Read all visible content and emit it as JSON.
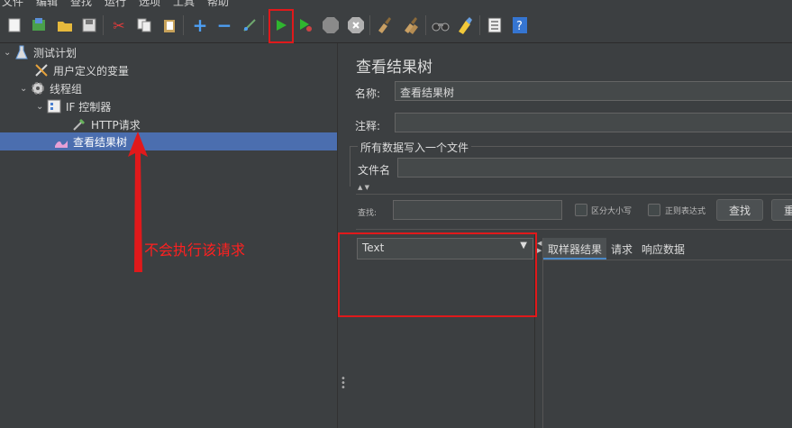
{
  "menu": {
    "items": [
      "文件",
      "编辑",
      "查找",
      "运行",
      "选项",
      "工具",
      "帮助"
    ]
  },
  "toolbar": {
    "icons": [
      "new-icon",
      "templates-icon",
      "open-icon",
      "save-icon",
      "cut-icon",
      "copy-icon",
      "paste-icon",
      "expand-icon",
      "collapse-icon",
      "toggle-icon",
      "start-icon",
      "start-no-pause-icon",
      "stop-icon",
      "shutdown-icon",
      "clear-icon",
      "clear-all-icon",
      "search-icon",
      "reset-search-icon",
      "function-helper-icon",
      "help-icon"
    ]
  },
  "tree": {
    "items": [
      {
        "label": "测试计划",
        "icon": "test-plan-icon"
      },
      {
        "label": "用户定义的变量",
        "icon": "user-variables-icon"
      },
      {
        "label": "线程组",
        "icon": "thread-group-icon"
      },
      {
        "label": "IF 控制器",
        "icon": "if-controller-icon"
      },
      {
        "label": "HTTP请求",
        "icon": "http-request-icon"
      },
      {
        "label": "查看结果树",
        "icon": "results-tree-icon"
      }
    ]
  },
  "annotation": {
    "text": "不会执行该请求"
  },
  "panel": {
    "title": "查看结果树",
    "name_label": "名称:",
    "name_value": "查看结果树",
    "comment_label": "注释:",
    "comment_value": "",
    "file_section": "所有数据写入一个文件",
    "filename_label": "文件名",
    "filename_value": "",
    "search_label": "查找:",
    "case_label": "区分大小写",
    "regex_label": "正则表达式",
    "find_button": "查找",
    "reset_button": "重",
    "renderer_value": "Text",
    "tabs": [
      "取样器结果",
      "请求",
      "响应数据"
    ]
  },
  "colors": {
    "background": "#3c3f41",
    "selection": "#4b6eaf",
    "annotation": "#ff2020"
  }
}
